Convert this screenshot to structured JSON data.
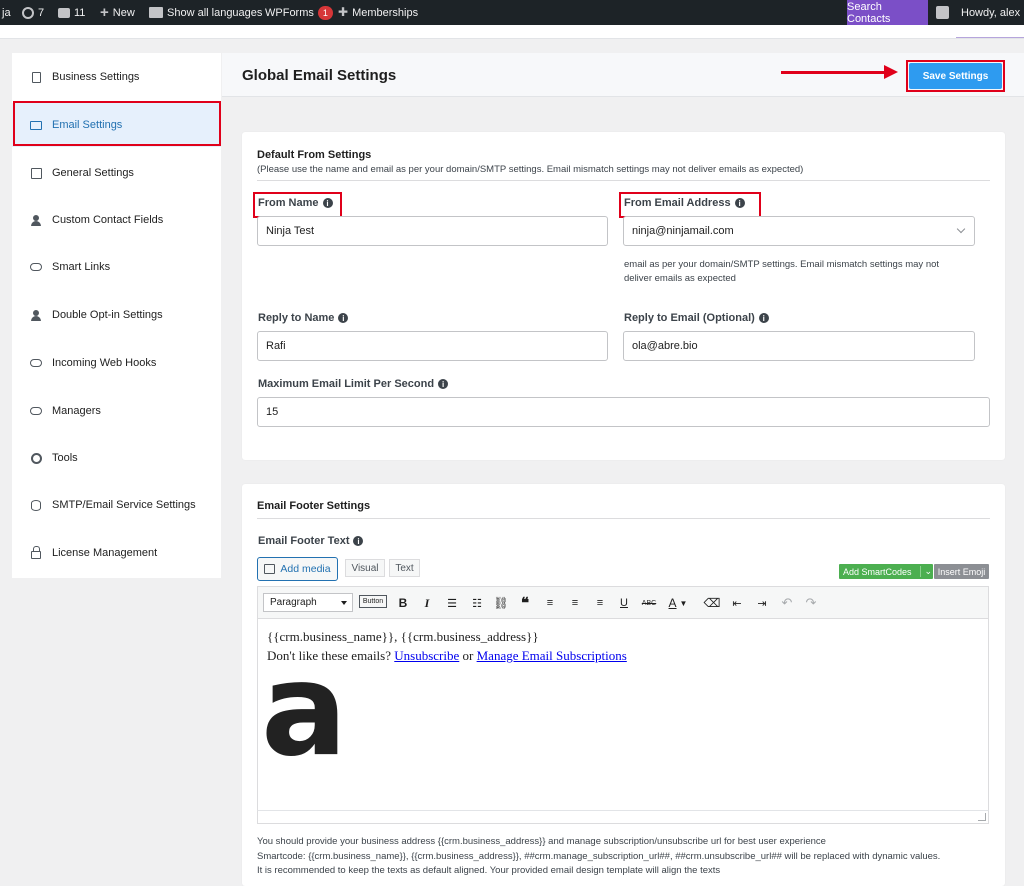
{
  "admin_bar": {
    "site_fragment": "ja",
    "updates_count": "7",
    "comments_count": "11",
    "new_label": "New",
    "languages_label": "Show all languages",
    "wpforms_label": "WPForms",
    "wpforms_badge": "1",
    "memberships_label": "Memberships",
    "search_contacts_label": "Search Contacts",
    "howdy_label": "Howdy, alex"
  },
  "sidebar": {
    "items": [
      {
        "label": "Business Settings",
        "icon": "document-icon"
      },
      {
        "label": "Email Settings",
        "icon": "mail-icon",
        "active": true
      },
      {
        "label": "General Settings",
        "icon": "settings-doc-icon"
      },
      {
        "label": "Custom Contact Fields",
        "icon": "person-icon"
      },
      {
        "label": "Smart Links",
        "icon": "link-icon"
      },
      {
        "label": "Double Opt-in Settings",
        "icon": "person-icon"
      },
      {
        "label": "Incoming Web Hooks",
        "icon": "link-icon"
      },
      {
        "label": "Managers",
        "icon": "link-icon"
      },
      {
        "label": "Tools",
        "icon": "gear-icon"
      },
      {
        "label": "SMTP/Email Service Settings",
        "icon": "database-icon"
      },
      {
        "label": "License Management",
        "icon": "lock-icon"
      }
    ]
  },
  "header": {
    "title": "Global Email Settings",
    "save_label": "Save Settings"
  },
  "default_from": {
    "title": "Default From Settings",
    "subtitle": "(Please use the name and email as per your domain/SMTP settings. Email mismatch settings may not deliver emails as expected)",
    "from_name_label": "From Name",
    "from_name_value": "Ninja Test",
    "from_email_label": "From Email Address",
    "from_email_value": "ninja@ninjamail.com",
    "from_email_help": "email as per your domain/SMTP settings. Email mismatch settings may not deliver emails as expected",
    "reply_name_label": "Reply to Name",
    "reply_name_value": "Rafi",
    "reply_email_label": "Reply to Email (Optional)",
    "reply_email_value": "ola@abre.bio",
    "max_limit_label": "Maximum Email Limit Per Second",
    "max_limit_value": "15"
  },
  "footer_settings": {
    "title": "Email Footer Settings",
    "footer_text_label": "Email Footer Text",
    "add_media_label": "Add media",
    "tab_visual": "Visual",
    "tab_text": "Text",
    "smartcodes_label": "Add SmartCodes",
    "insert_emoji_label": "Insert Emoji",
    "format_select_value": "Paragraph",
    "button_label": "Button",
    "editor_line1": "{{crm.business_name}}, {{crm.business_address}}",
    "editor_line2_prefix": "Don't like these emails? ",
    "editor_unsubscribe": "Unsubscribe",
    "editor_or": " or ",
    "editor_manage": "Manage Email Subscriptions",
    "logo_glyph": "a",
    "note1": "You should provide your business address {{crm.business_address}} and manage subscription/unsubscribe url for best user experience",
    "note2": "Smartcode: {{crm.business_name}}, {{crm.business_address}}, ##crm.manage_subscription_url##, ##crm.unsubscribe_url## will be replaced with dynamic values.",
    "note3": "It is recommended to keep the texts as default aligned. Your provided email design template will align the texts"
  },
  "colors": {
    "accent": "#2e9bf0",
    "highlight": "#e0001a",
    "smartcodes": "#4caf50",
    "search_contacts": "#7b4fc7"
  }
}
